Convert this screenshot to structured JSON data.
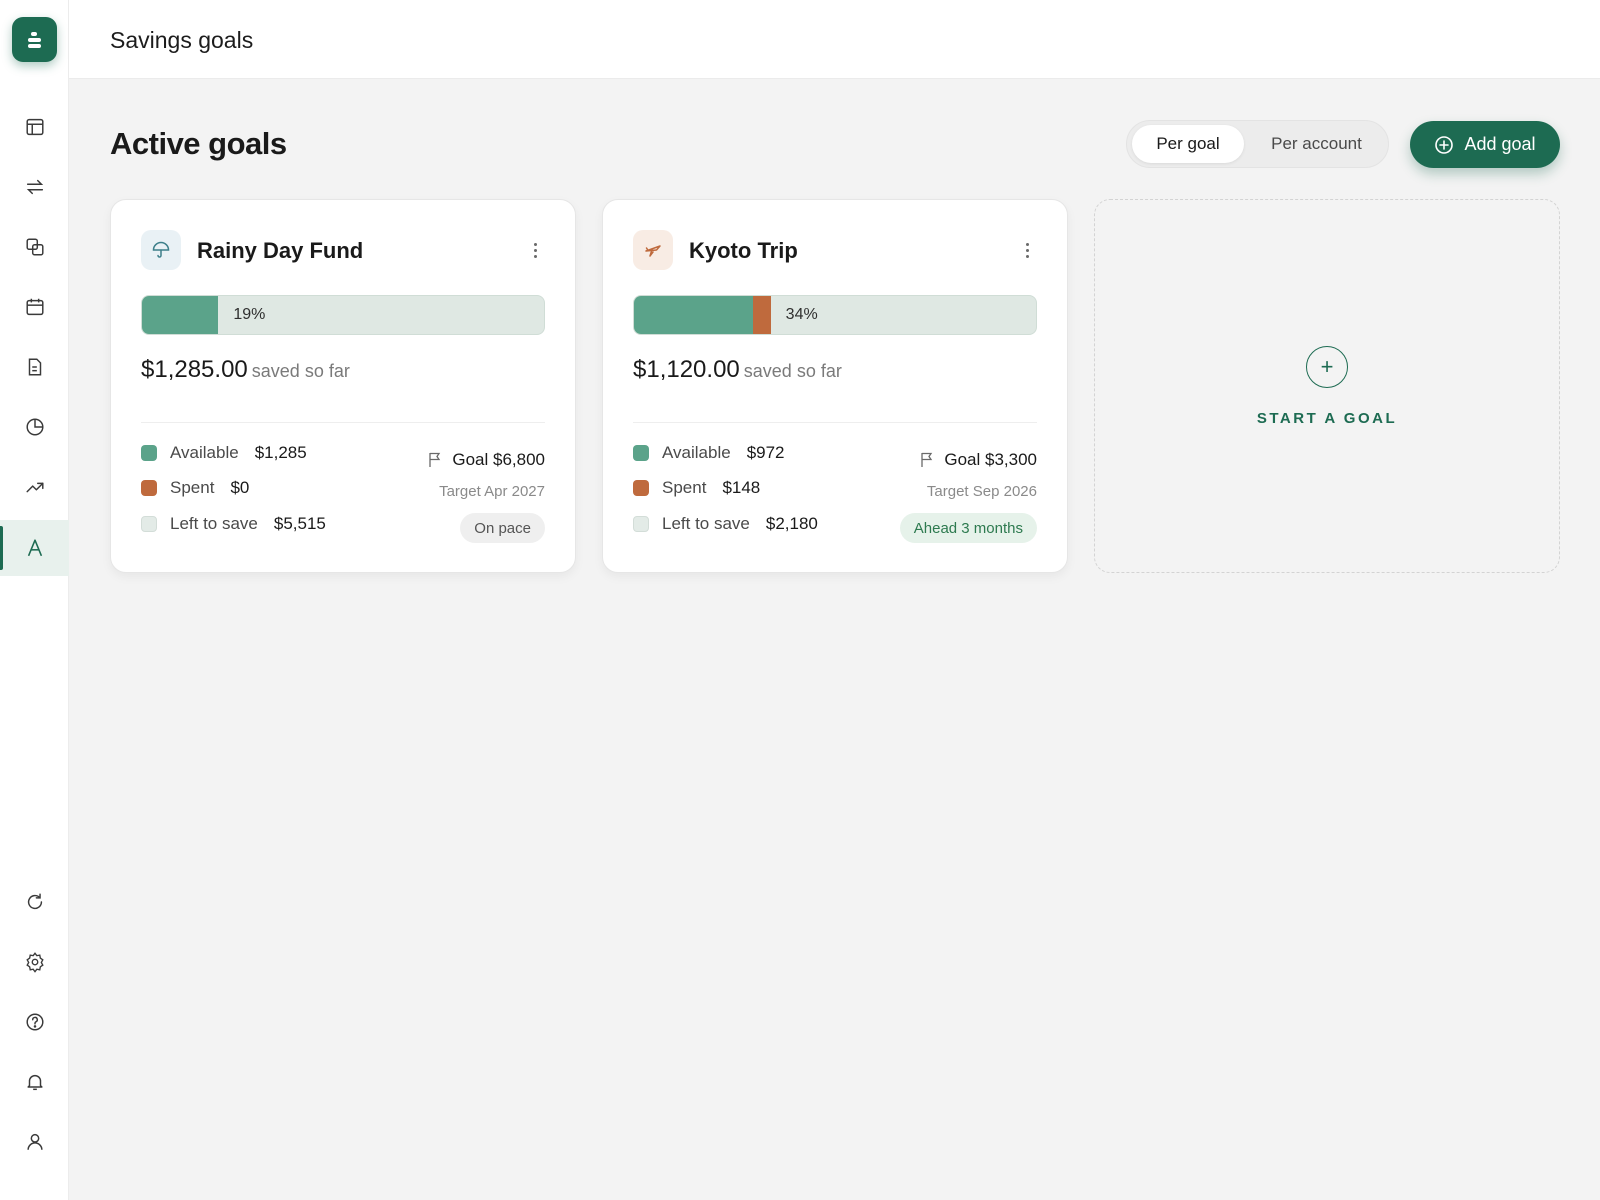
{
  "topbar": {
    "title": "Savings goals"
  },
  "sidebar": {
    "items": [
      {
        "icon": "dashboard-icon"
      },
      {
        "icon": "transfer-icon"
      },
      {
        "icon": "accounts-icon"
      },
      {
        "icon": "calendar-icon"
      },
      {
        "icon": "document-icon"
      },
      {
        "icon": "pie-chart-icon"
      },
      {
        "icon": "trend-icon"
      },
      {
        "icon": "goals-icon",
        "active": true
      }
    ],
    "bottom_items": [
      {
        "icon": "refresh-icon"
      },
      {
        "icon": "gear-icon"
      },
      {
        "icon": "help-icon"
      },
      {
        "icon": "bell-icon"
      },
      {
        "icon": "user-icon"
      }
    ]
  },
  "main": {
    "title": "Active goals",
    "view_toggle": {
      "selected": "Per goal",
      "options": [
        "Per goal",
        "Per account"
      ]
    },
    "add_button": "Add goal",
    "goals": [
      {
        "name": "Rainy Day Fund",
        "icon": "umbrella-icon",
        "percent_label": "19%",
        "progress": {
          "available_fraction": 0.19,
          "spent_fraction": 0
        },
        "saved": "$1,285.00",
        "saved_suffix": "saved so far",
        "legend": [
          {
            "label": "Available",
            "value": "$1,285"
          },
          {
            "label": "Spent",
            "value": "$0"
          },
          {
            "label": "Left to save",
            "value": "$5,515"
          }
        ],
        "goal": "Goal $6,800",
        "target": "Target Apr 2027",
        "status": "On pace"
      },
      {
        "name": "Kyoto Trip",
        "icon": "airplane-icon",
        "percent_label": "34%",
        "progress": {
          "available_fraction": 0.295,
          "spent_fraction": 0.045
        },
        "saved": "$1,120.00",
        "saved_suffix": "saved so far",
        "legend": [
          {
            "label": "Available",
            "value": "$972"
          },
          {
            "label": "Spent",
            "value": "$148"
          },
          {
            "label": "Left to save",
            "value": "$2,180"
          }
        ],
        "goal": "Goal $3,300",
        "target": "Target Sep 2026",
        "status": "Ahead 3 months"
      }
    ],
    "new_goal_label": "START A GOAL"
  },
  "colors": {
    "brand": "#1d6b52",
    "available": "#5ba38a",
    "spent": "#bf6a3d",
    "left": "#dfe8e3"
  }
}
